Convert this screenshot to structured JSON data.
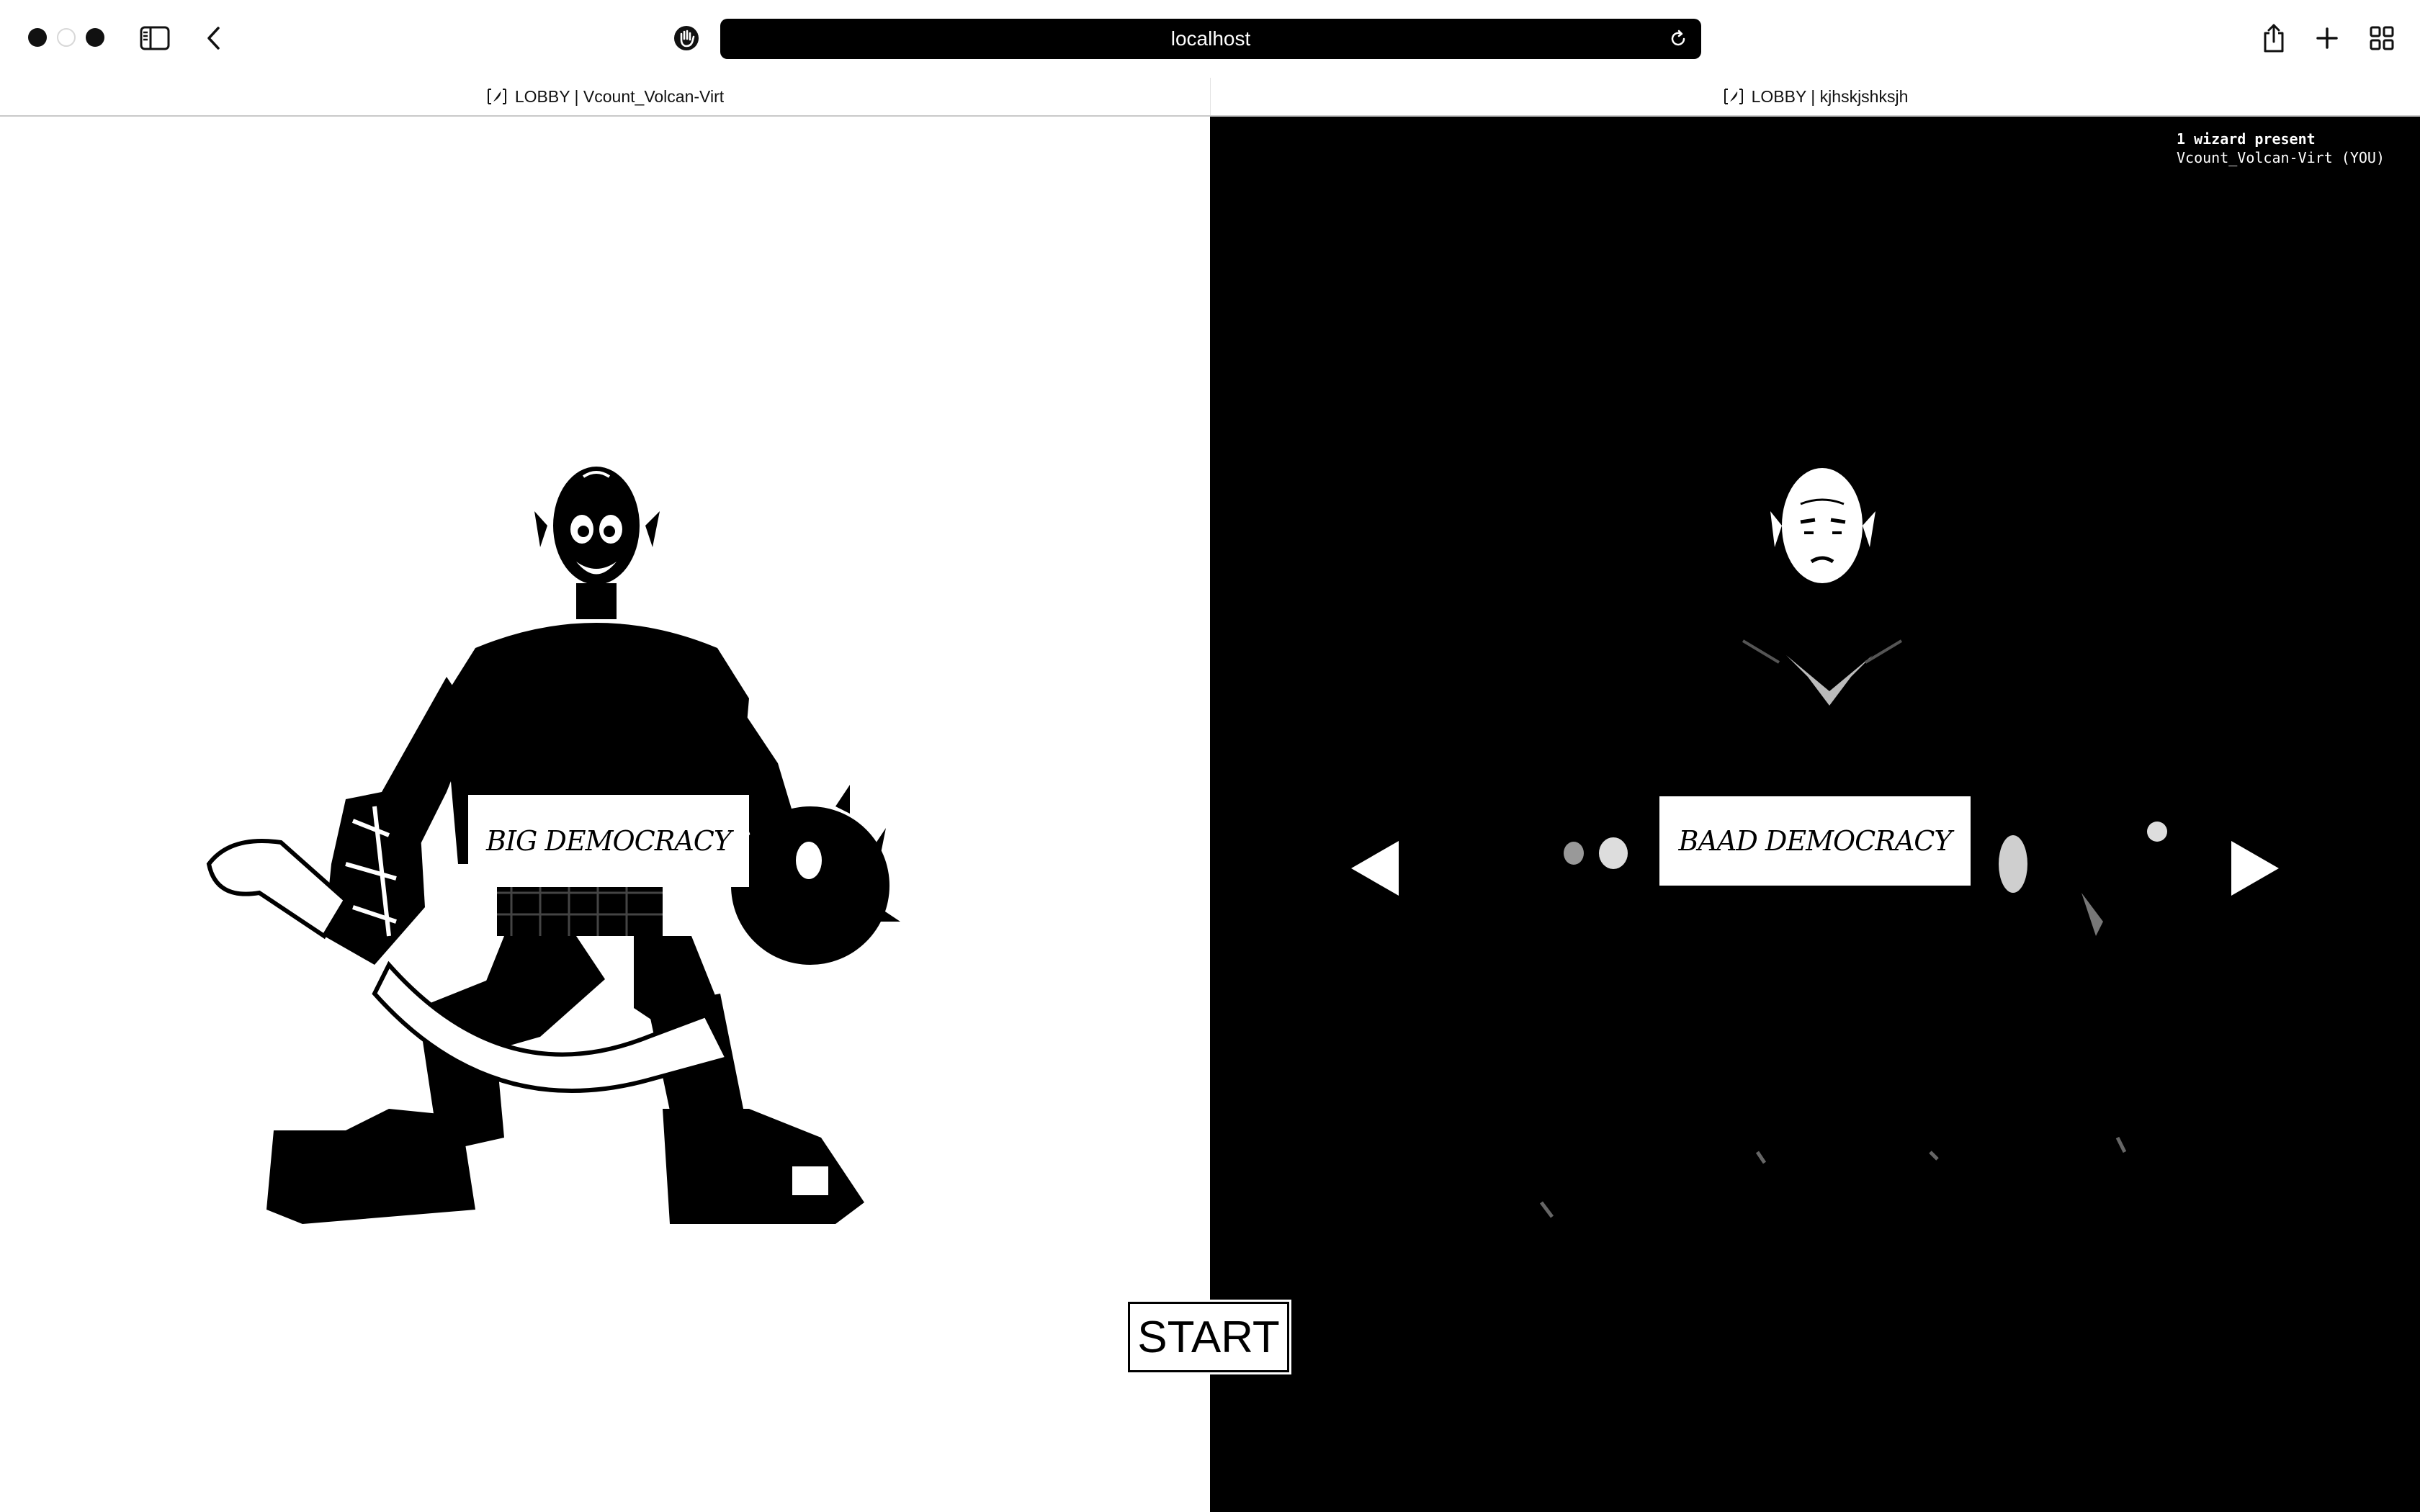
{
  "browser": {
    "url": "localhost",
    "tabs": [
      {
        "label": "LOBBY | Vcount_Volcan-Virt"
      },
      {
        "label": "LOBBY | kjhskjshksjh"
      }
    ],
    "icons": {
      "sidebar": "sidebar-icon",
      "back": "chevron-left-icon",
      "privacy": "hand-icon",
      "reload": "reload-icon",
      "share": "share-icon",
      "new_tab": "plus-icon",
      "overview": "grid-icon"
    }
  },
  "lobby": {
    "presence": {
      "count_text": "1 wizard present",
      "players": [
        "Vcount_Volcan-Virt (YOU)"
      ]
    },
    "left_character": {
      "name": "BIG DEMOCRACY"
    },
    "right_character": {
      "name": "BAAD DEMOCRACY"
    },
    "start_label": "START"
  },
  "colors": {
    "left_bg": "#ffffff",
    "right_bg": "#000000"
  }
}
